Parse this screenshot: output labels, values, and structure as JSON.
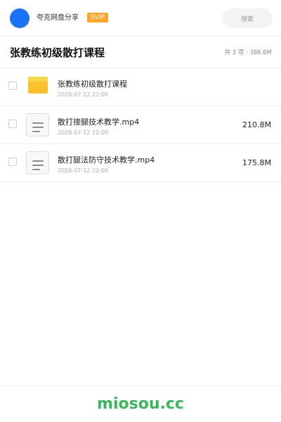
{
  "header": {
    "brand": "夸克网盘分享",
    "badge": "SVIP",
    "search_placeholder": "搜索"
  },
  "folder": {
    "title": "张教练初级散打课程",
    "summary": "共 3 项 · 386.6M"
  },
  "files": [
    {
      "name": "张教练初级散打课程",
      "date": "2026-07-12 22:00",
      "size": "",
      "icon": "folder-icon"
    },
    {
      "name": "散打接腿技术教学.mp4",
      "date": "2026-07-12 22:00",
      "size": "210.8M",
      "icon": "video-file-icon"
    },
    {
      "name": "散打腿法防守技术教学.mp4",
      "date": "2026-07-12 22:00",
      "size": "175.8M",
      "icon": "video-file-icon"
    }
  ],
  "footer": {
    "site": "miosou.cc"
  },
  "colors": {
    "accent": "#1a73f5",
    "badge": "#f9a52e",
    "folder": "#fbc02d",
    "footer_text": "#3cb55c"
  }
}
